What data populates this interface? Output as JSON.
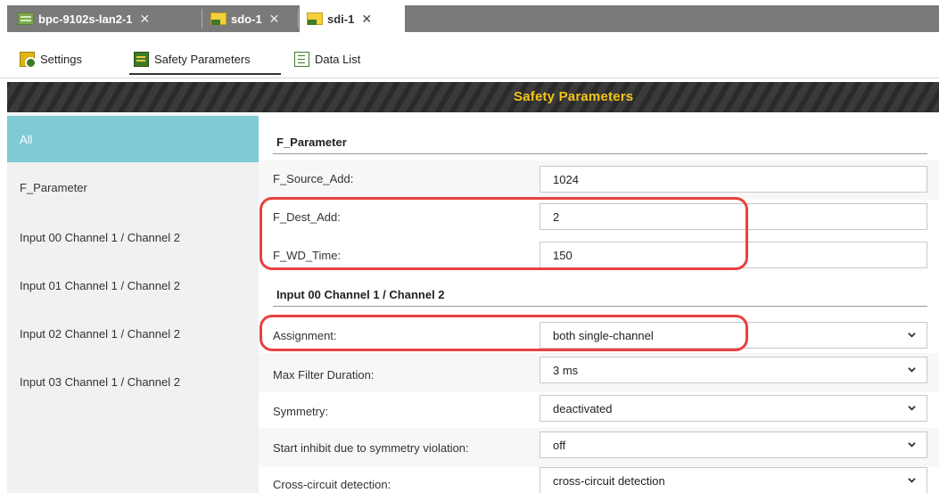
{
  "tabs": [
    {
      "label": "bpc-9102s-lan2-1",
      "close": "✕",
      "icon": "network-device-icon",
      "active": false
    },
    {
      "label": "sdo-1",
      "close": "✕",
      "icon": "module-icon",
      "active": false
    },
    {
      "label": "sdi-1",
      "close": "✕",
      "icon": "module-icon",
      "active": true
    }
  ],
  "toolbar": {
    "settings_label": "Settings",
    "safety_label": "Safety Parameters",
    "datalist_label": "Data List"
  },
  "banner": {
    "title": "Safety Parameters"
  },
  "sidebar": {
    "items": [
      {
        "label": "All",
        "active": true
      },
      {
        "label": "F_Parameter"
      },
      {
        "label": "Input 00 Channel 1 / Channel 2"
      },
      {
        "label": "Input 01 Channel 1 / Channel 2"
      },
      {
        "label": "Input 02 Channel 1 / Channel 2"
      },
      {
        "label": "Input 03 Channel 1 / Channel 2"
      }
    ]
  },
  "main": {
    "section1": "F_Parameter",
    "section2": "Input 00 Channel 1 / Channel 2",
    "fields": [
      {
        "label": "F_Source_Add:",
        "value": "1024",
        "type": "readonly"
      },
      {
        "label": "F_Dest_Add:",
        "value": "2",
        "type": "input"
      },
      {
        "label": "F_WD_Time:",
        "value": "150",
        "type": "input"
      },
      {
        "label": "Assignment:",
        "value": "both single-channel",
        "type": "select"
      },
      {
        "label": "Max Filter Duration:",
        "value": "3 ms",
        "type": "select"
      },
      {
        "label": "Symmetry:",
        "value": "deactivated",
        "type": "select"
      },
      {
        "label": "Start inhibit due to symmetry violation:",
        "value": "off",
        "type": "select"
      },
      {
        "label": "Cross-circuit detection:",
        "value": "cross-circuit detection",
        "type": "select"
      }
    ]
  },
  "colors": {
    "accent": "#7ecbd6",
    "banner_text": "#f5c518",
    "highlight": "#e8413f",
    "brand_green": "#3e7b27"
  }
}
